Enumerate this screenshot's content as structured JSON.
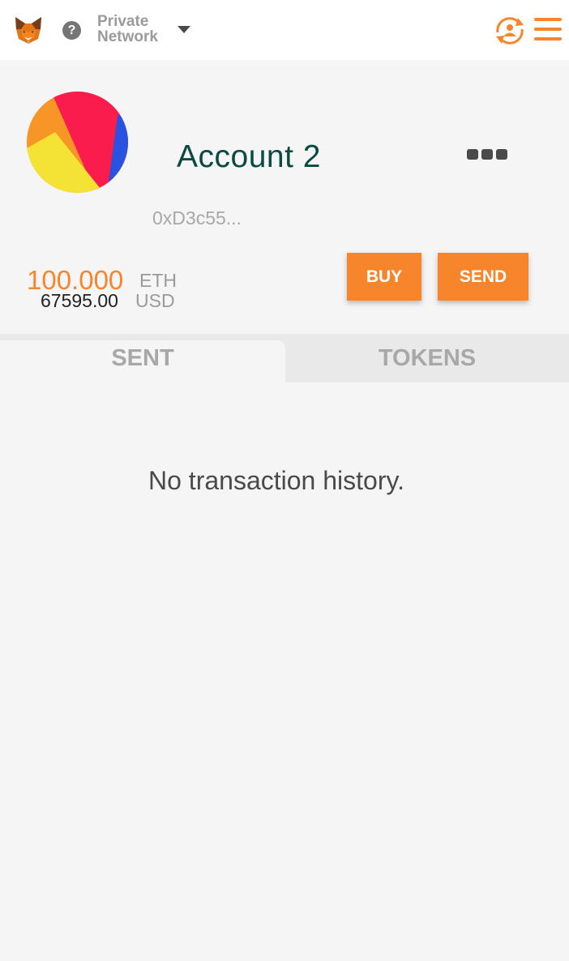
{
  "header": {
    "logo_icon": "metamask-fox-icon",
    "help_icon": "help-circle-icon",
    "help_glyph": "?",
    "network_line1": "Private",
    "network_line2": "Network",
    "network_dropdown_icon": "caret-down-icon",
    "account_switch_icon": "switch-account-icon",
    "menu_icon": "hamburger-menu-icon"
  },
  "account": {
    "name": "Account 2",
    "address": "0xD3c55...",
    "avatar_icon": "identicon",
    "options_icon": "more-options-icon",
    "eth_amount": "100.000",
    "eth_unit": "ETH",
    "usd_amount": "67595.00",
    "usd_unit": "USD"
  },
  "actions": {
    "buy_label": "BUY",
    "send_label": "SEND"
  },
  "tabs": [
    {
      "label": "SENT",
      "active": true
    },
    {
      "label": "TOKENS",
      "active": false
    }
  ],
  "history": {
    "empty_message": "No transaction history."
  },
  "colors": {
    "accent": "#f6852c",
    "account_name": "#0b4a42",
    "page_bg": "#f5f5f5",
    "topbar_bg": "#ffffff",
    "tab_bar_bg": "#e9e9e9",
    "muted_text": "#9b9b9b"
  }
}
